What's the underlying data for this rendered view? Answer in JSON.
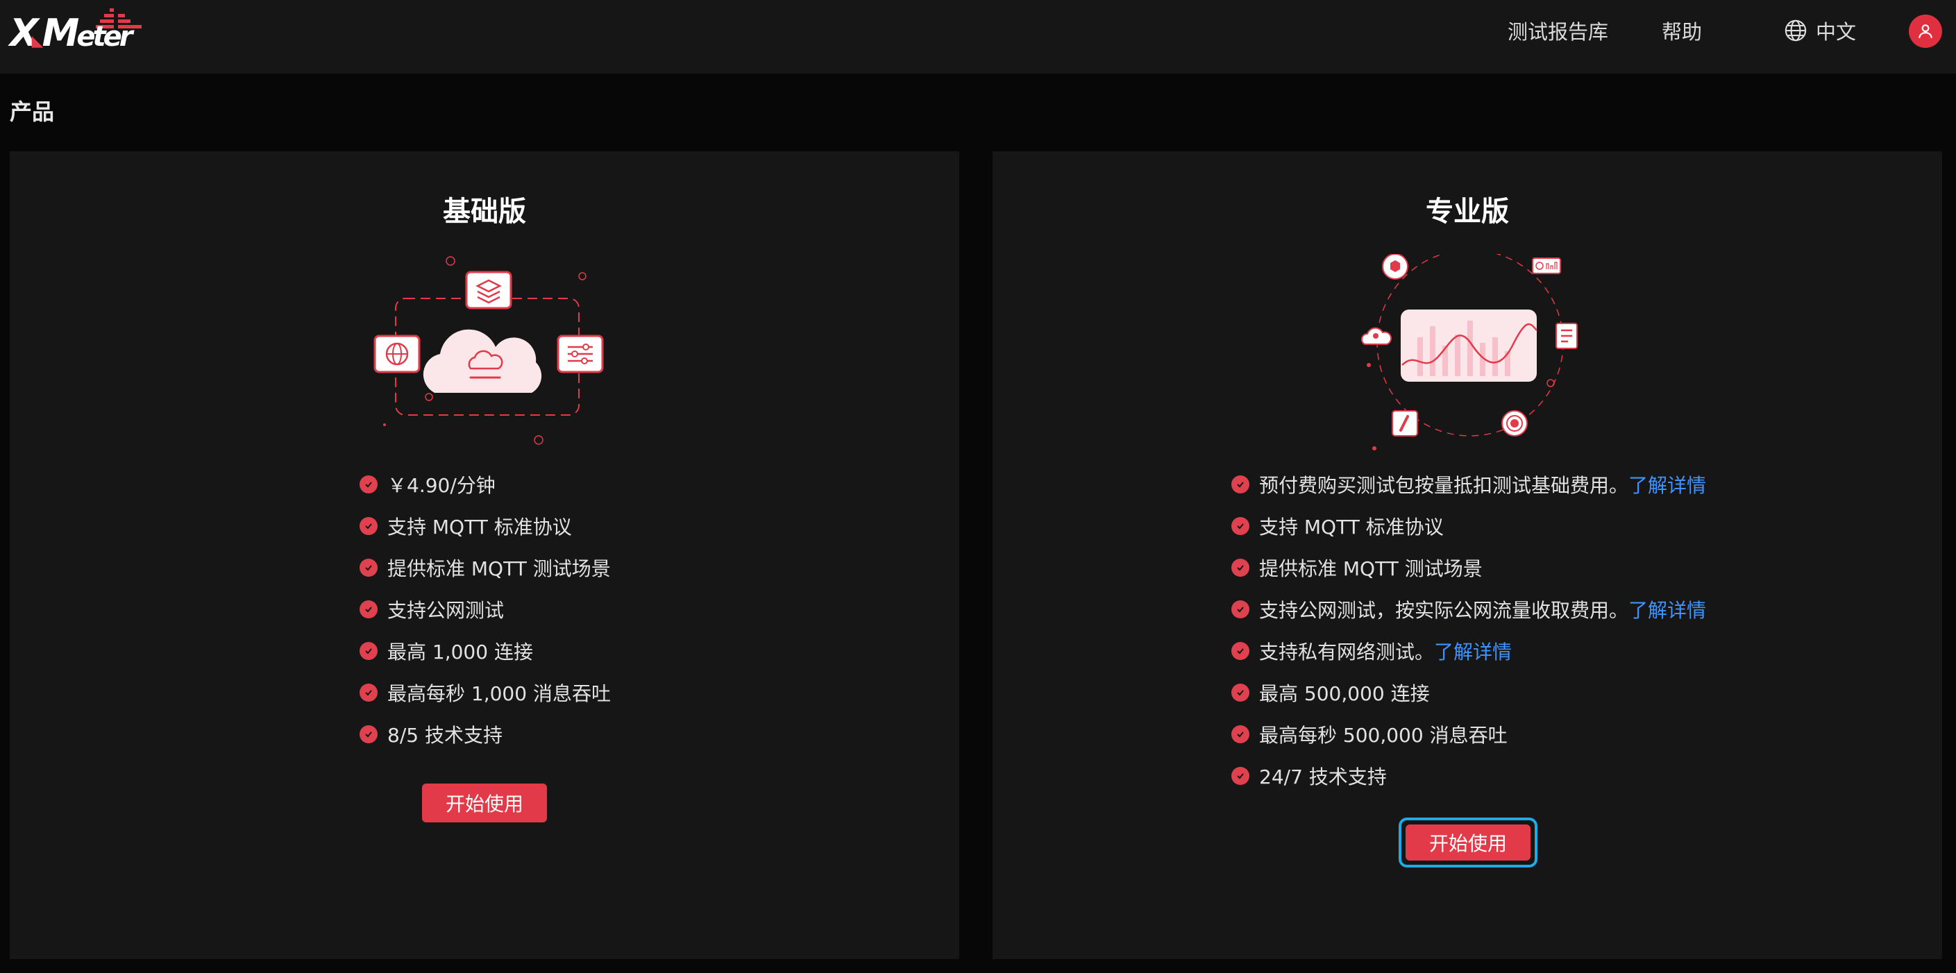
{
  "brand": {
    "logo_text": "XMeter"
  },
  "header": {
    "nav_reports": "测试报告库",
    "nav_help": "帮助",
    "language": "中文"
  },
  "page": {
    "title": "产品"
  },
  "plans": {
    "basic": {
      "title": "基础版",
      "features": [
        "￥4.90/分钟",
        "支持 MQTT 标准协议",
        "提供标准 MQTT 测试场景",
        "支持公网测试",
        "最高 1,000 连接",
        "最高每秒 1,000 消息吞吐",
        "8/5 技术支持"
      ],
      "button": "开始使用"
    },
    "pro": {
      "title": "专业版",
      "features": [
        {
          "text": "预付费购买测试包按量抵扣测试基础费用。",
          "link": "了解详情"
        },
        {
          "text": "支持 MQTT 标准协议",
          "link": ""
        },
        {
          "text": "提供标准 MQTT 测试场景",
          "link": ""
        },
        {
          "text": "支持公网测试，按实际公网流量收取费用。",
          "link": "了解详情"
        },
        {
          "text": "支持私有网络测试。",
          "link": "了解详情"
        },
        {
          "text": "最高 500,000 连接",
          "link": ""
        },
        {
          "text": "最高每秒 500,000 消息吞吐",
          "link": ""
        },
        {
          "text": "24/7 技术支持",
          "link": ""
        }
      ],
      "button": "开始使用"
    }
  },
  "colors": {
    "accent": "#e23a48",
    "link": "#3d94ff",
    "focus_ring": "#21a8e6",
    "card_bg": "#161616"
  },
  "icons": [
    "globe-icon",
    "user-icon",
    "check-circle-icon",
    "cloud-icon",
    "layers-icon",
    "globe-icon",
    "sliders-icon",
    "chart-icon"
  ]
}
